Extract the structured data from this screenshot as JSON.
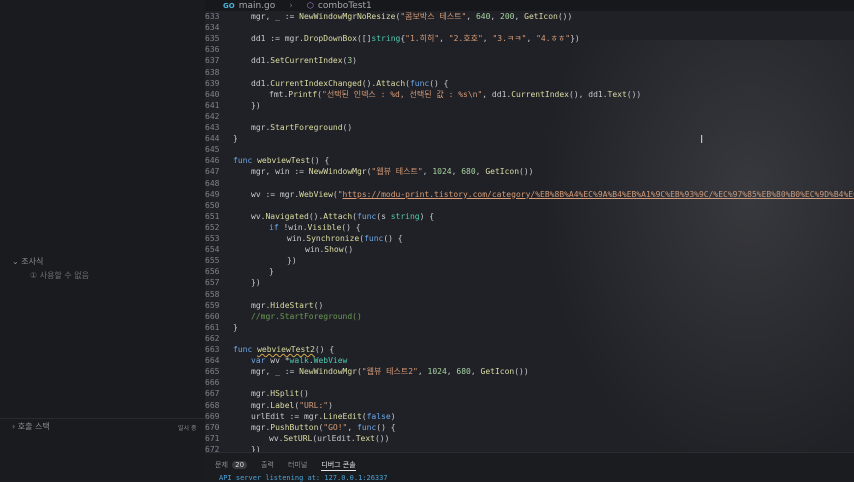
{
  "tabs": [
    {
      "label": "main.go",
      "icon": "go-file-icon"
    },
    {
      "label": "comboTest1",
      "icon": "go-file-icon"
    }
  ],
  "sidebar": {
    "outline_label": "조사식",
    "outline_hint": "① 사용할 수 없음",
    "bottom_label": "호출 스택",
    "bottom_right_label": "일시 중"
  },
  "code_lines": [
    {
      "n": "633",
      "indent": 1,
      "html": "mgr, _ := <span class=\"f\">NewWindowMgrNoResize</span>(<span class=\"s\">\"콤보박스 테스트\"</span>, <span class=\"n\">640</span>, <span class=\"n\">200</span>, <span class=\"f\">GetIcon</span>())"
    },
    {
      "n": "634",
      "indent": 0,
      "html": ""
    },
    {
      "n": "635",
      "indent": 1,
      "html": "dd1 := mgr.<span class=\"f\">DropDownBox</span>([]<span class=\"t\">string</span>{<span class=\"s\">\"1.히히\"</span>, <span class=\"s\">\"2.호호\"</span>, <span class=\"s\">\"3.ㅋㅋ\"</span>, <span class=\"s\">\"4.ㅎㅎ\"</span>})"
    },
    {
      "n": "636",
      "indent": 0,
      "html": ""
    },
    {
      "n": "637",
      "indent": 1,
      "html": "dd1.<span class=\"f\">SetCurrentIndex</span>(<span class=\"n\">3</span>)"
    },
    {
      "n": "638",
      "indent": 0,
      "html": ""
    },
    {
      "n": "639",
      "indent": 1,
      "html": "dd1.<span class=\"f\">CurrentIndexChanged</span>().<span class=\"f\">Attach</span>(<span class=\"k\">func</span>() {"
    },
    {
      "n": "640",
      "indent": 2,
      "html": "fmt.<span class=\"f\">Printf</span>(<span class=\"s\">\"선택된 인덱스 : %d, 선택된 값 : %s\\n\"</span>, dd1.<span class=\"f\">CurrentIndex</span>(), dd1.<span class=\"f\">Text</span>())"
    },
    {
      "n": "641",
      "indent": 1,
      "html": "})"
    },
    {
      "n": "642",
      "indent": 0,
      "html": ""
    },
    {
      "n": "643",
      "indent": 1,
      "html": "mgr.<span class=\"f\">StartForeground</span>()"
    },
    {
      "n": "644",
      "indent": 0,
      "html": "}"
    },
    {
      "n": "645",
      "indent": 0,
      "html": ""
    },
    {
      "n": "646",
      "indent": 0,
      "html": "<span class=\"k\">func</span> <span class=\"f\">webviewTest</span>() {"
    },
    {
      "n": "647",
      "indent": 1,
      "html": "mgr, win := <span class=\"f\">NewWindowMgr</span>(<span class=\"s\">\"웹뷰 테스트\"</span>, <span class=\"n\">1024</span>, <span class=\"n\">680</span>, <span class=\"f\">GetIcon</span>())"
    },
    {
      "n": "648",
      "indent": 0,
      "html": ""
    },
    {
      "n": "649",
      "indent": 1,
      "html": "wv := mgr.<span class=\"f\">WebView</span>(<span class=\"s\">\"</span><span class=\"u\">https://modu-print.tistory.com/category/%EB%8B%A4%EC%9A%B4%EB%A1%9C%EB%93%9C/%EC%97%85%EB%80%B0%EC%9D%B4%EC%8A%B8</span>"
    },
    {
      "n": "650",
      "indent": 0,
      "html": ""
    },
    {
      "n": "651",
      "indent": 1,
      "html": "wv.<span class=\"f\">Navigated</span>().<span class=\"f\">Attach</span>(<span class=\"k\">func</span>(s <span class=\"t\">string</span>) {"
    },
    {
      "n": "652",
      "indent": 2,
      "html": "<span class=\"k\">if</span> !win.<span class=\"f\">Visible</span>() {"
    },
    {
      "n": "653",
      "indent": 3,
      "html": "win.<span class=\"f\">Synchronize</span>(<span class=\"k\">func</span>() {"
    },
    {
      "n": "654",
      "indent": 4,
      "html": "win.<span class=\"f\">Show</span>()"
    },
    {
      "n": "655",
      "indent": 3,
      "html": "})"
    },
    {
      "n": "656",
      "indent": 2,
      "html": "}"
    },
    {
      "n": "657",
      "indent": 1,
      "html": "})"
    },
    {
      "n": "658",
      "indent": 0,
      "html": ""
    },
    {
      "n": "659",
      "indent": 1,
      "html": "mgr.<span class=\"f\">HideStart</span>()"
    },
    {
      "n": "660",
      "indent": 1,
      "html": "<span class=\"c\">//mgr.StartForeground()</span>"
    },
    {
      "n": "661",
      "indent": 0,
      "html": "}"
    },
    {
      "n": "662",
      "indent": 0,
      "html": ""
    },
    {
      "n": "663",
      "indent": 0,
      "html": "<span class=\"k\">func</span> <span class=\"f sq\">webviewTest2</span>() {"
    },
    {
      "n": "664",
      "indent": 1,
      "html": "<span class=\"k\">var</span> wv *<span class=\"t\">walk</span>.<span class=\"t\">WebView</span>"
    },
    {
      "n": "665",
      "indent": 1,
      "html": "mgr, _ := <span class=\"f\">NewWindowMgr</span>(<span class=\"s\">\"웹뷰 테스트2\"</span>, <span class=\"n\">1024</span>, <span class=\"n\">680</span>, <span class=\"f\">GetIcon</span>())"
    },
    {
      "n": "666",
      "indent": 0,
      "html": ""
    },
    {
      "n": "667",
      "indent": 1,
      "html": "mgr.<span class=\"f\">HSplit</span>()"
    },
    {
      "n": "668",
      "indent": 1,
      "html": "mgr.<span class=\"f\">Label</span>(<span class=\"s\">\"URL:\"</span>)"
    },
    {
      "n": "669",
      "indent": 1,
      "html": "urlEdit := mgr.<span class=\"f\">LineEdit</span>(<span class=\"k\">false</span>)"
    },
    {
      "n": "670",
      "indent": 1,
      "html": "mgr.<span class=\"f\">PushButton</span>(<span class=\"s\">\"GO!\"</span>, <span class=\"k\">func</span>() {"
    },
    {
      "n": "671",
      "indent": 2,
      "html": "wv.<span class=\"f\">SetURL</span>(urlEdit.<span class=\"f\">Text</span>())"
    },
    {
      "n": "672",
      "indent": 1,
      "html": "})"
    },
    {
      "n": "673",
      "indent": 1,
      "html": "mgr.<span class=\"f\">EndSplit</span>()"
    }
  ],
  "panel": {
    "tabs": [
      "문제",
      "출력",
      "터미널",
      "디버그 콘솔"
    ],
    "problems_count": "20",
    "active_tab": "디버그 콘솔",
    "output_line": "API server listening at: 127.0.0.1:26337"
  },
  "colors": {
    "editor_bg": "#202126",
    "sidebar_bg": "#1a1b1f",
    "keyword": "#6ba7e8",
    "function": "#dcdca4",
    "string": "#d89c78",
    "comment": "#6a9955"
  }
}
